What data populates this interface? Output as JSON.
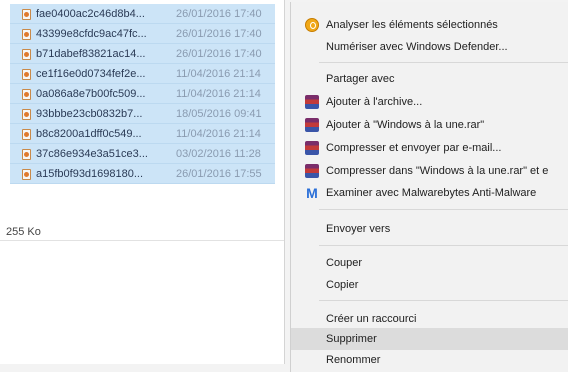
{
  "files": [
    {
      "name": "fae0400ac2c46d8b4...",
      "date": "26/01/2016 17:40"
    },
    {
      "name": "43399e8cfdc9ac47fc...",
      "date": "26/01/2016 17:40"
    },
    {
      "name": "b71dabef83821ac14...",
      "date": "26/01/2016 17:40"
    },
    {
      "name": "ce1f16e0d0734fef2e...",
      "date": "11/04/2016 21:14"
    },
    {
      "name": "0a086a8e7b00fc509...",
      "date": "11/04/2016 21:14"
    },
    {
      "name": "93bbbe23cb0832b7...",
      "date": "18/05/2016 09:41"
    },
    {
      "name": "b8c8200a1dff0c549...",
      "date": "11/04/2016 21:14"
    },
    {
      "name": "37c86e934e3a51ce3...",
      "date": "03/02/2016 11:28"
    },
    {
      "name": "a15fb0f93d1698180...",
      "date": "26/01/2016 17:55"
    }
  ],
  "status": {
    "size": "255 Ko"
  },
  "menu": {
    "analyze": "Analyser les éléments sélectionnés",
    "defender": "Numériser avec Windows Defender...",
    "share": "Partager avec",
    "add_archive": "Ajouter à l'archive...",
    "add_rar": "Ajouter à \"Windows à la une.rar\"",
    "compress_email": "Compresser et envoyer par e-mail...",
    "compress_rar_email": "Compresser dans \"Windows à la une.rar\" et e",
    "malwarebytes": "Examiner avec Malwarebytes Anti-Malware",
    "send_to": "Envoyer vers",
    "cut": "Couper",
    "copy": "Copier",
    "shortcut": "Créer un raccourci",
    "delete": "Supprimer",
    "rename": "Renommer"
  },
  "icons": {
    "analyze": "shield-scan-icon",
    "archive": "winrar-archive-icon",
    "malwarebytes": "malwarebytes-icon"
  },
  "colors": {
    "selection": "#cce4f7",
    "menu_bg": "#f2f2f2",
    "menu_highlight": "#dcdcdc"
  }
}
